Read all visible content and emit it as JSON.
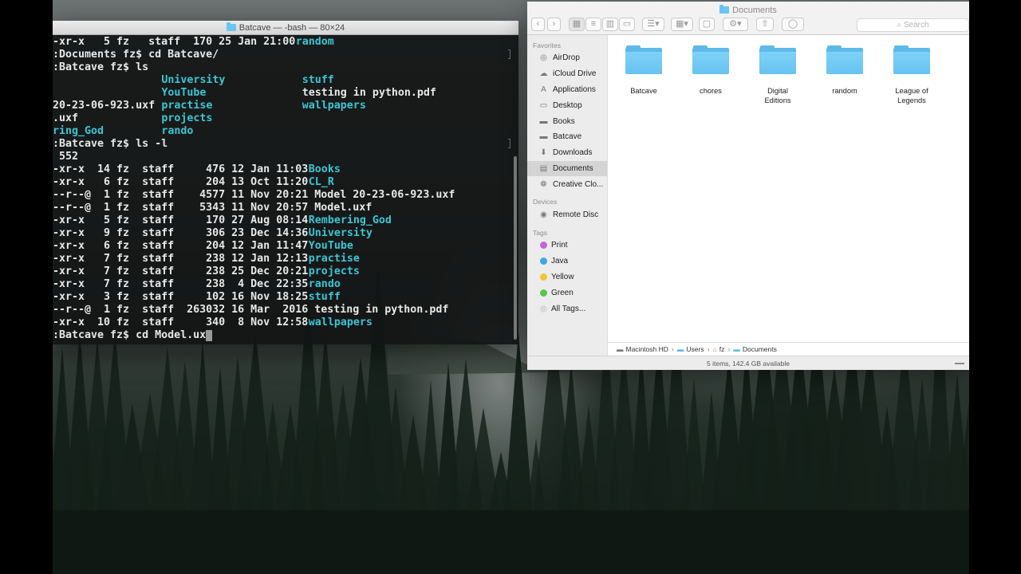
{
  "terminal": {
    "title": "Batcave — -bash — 80×24",
    "lines": [
      [
        {
          "t": "-xr-x   5 fz   staff  170 25 Jan 21:00 ",
          "c": "n",
          "col": 0
        },
        {
          "t": "random",
          "c": "d",
          "col": 38
        }
      ],
      [
        {
          "t": ":Documents fz$ cd Batcave/",
          "c": "n",
          "col": 0
        }
      ],
      [
        {
          "t": ":Batcave fz$ ls",
          "c": "n",
          "col": 0
        }
      ],
      [
        {
          "t": "University",
          "c": "d",
          "col": 17
        },
        {
          "t": "stuff",
          "c": "d",
          "col": 39
        }
      ],
      [
        {
          "t": "YouTube",
          "c": "d",
          "col": 17
        },
        {
          "t": "testing in python.pdf",
          "c": "n",
          "col": 39
        }
      ],
      [
        {
          "t": "20-23-06-923.uxf ",
          "c": "n",
          "col": 0
        },
        {
          "t": "practise",
          "c": "d",
          "col": 17
        },
        {
          "t": "wallpapers",
          "c": "d",
          "col": 39
        }
      ],
      [
        {
          "t": ".uxf",
          "c": "n",
          "col": 0
        },
        {
          "t": "projects",
          "c": "d",
          "col": 17
        }
      ],
      [
        {
          "t": "ring_God",
          "c": "d",
          "col": 0
        },
        {
          "t": "rando",
          "c": "d",
          "col": 17
        }
      ],
      [
        {
          "t": ":Batcave fz$ ls -l",
          "c": "n",
          "col": 0
        }
      ],
      [
        {
          "t": " 552",
          "c": "n",
          "col": 0
        }
      ],
      [
        {
          "t": "-xr-x  14 fz  staff     476 12 Jan 11:03 ",
          "c": "n",
          "col": 0
        },
        {
          "t": "Books",
          "c": "d",
          "col": 40
        }
      ],
      [
        {
          "t": "-xr-x   6 fz  staff     204 13 Oct 11:20 ",
          "c": "n",
          "col": 0
        },
        {
          "t": "CL_R",
          "c": "d",
          "col": 40
        }
      ],
      [
        {
          "t": "--r--@  1 fz  staff    4577 11 Nov 20:21 Model 20-23-06-923.uxf",
          "c": "n",
          "col": 0
        }
      ],
      [
        {
          "t": "--r--@  1 fz  staff    5343 11 Nov 20:57 Model.uxf",
          "c": "n",
          "col": 0
        }
      ],
      [
        {
          "t": "-xr-x   5 fz  staff     170 27 Aug 08:14 ",
          "c": "n",
          "col": 0
        },
        {
          "t": "Rembering_God",
          "c": "d",
          "col": 40
        }
      ],
      [
        {
          "t": "-xr-x   9 fz  staff     306 23 Dec 14:36 ",
          "c": "n",
          "col": 0
        },
        {
          "t": "University",
          "c": "d",
          "col": 40
        }
      ],
      [
        {
          "t": "-xr-x   6 fz  staff     204 12 Jan 11:47 ",
          "c": "n",
          "col": 0
        },
        {
          "t": "YouTube",
          "c": "d",
          "col": 40
        }
      ],
      [
        {
          "t": "-xr-x   7 fz  staff     238 12 Jan 12:13 ",
          "c": "n",
          "col": 0
        },
        {
          "t": "practise",
          "c": "d",
          "col": 40
        }
      ],
      [
        {
          "t": "-xr-x   7 fz  staff     238 25 Dec 20:21 ",
          "c": "n",
          "col": 0
        },
        {
          "t": "projects",
          "c": "d",
          "col": 40
        }
      ],
      [
        {
          "t": "-xr-x   7 fz  staff     238  4 Dec 22:35 ",
          "c": "n",
          "col": 0
        },
        {
          "t": "rando",
          "c": "d",
          "col": 40
        }
      ],
      [
        {
          "t": "-xr-x   3 fz  staff     102 16 Nov 18:25 ",
          "c": "n",
          "col": 0
        },
        {
          "t": "stuff",
          "c": "d",
          "col": 40
        }
      ],
      [
        {
          "t": "--r--@  1 fz  staff  263032 16 Mar  2016 testing in python.pdf",
          "c": "n",
          "col": 0
        }
      ],
      [
        {
          "t": "-xr-x  10 fz  staff     340  8 Nov 12:58 ",
          "c": "n",
          "col": 0
        },
        {
          "t": "wallpapers",
          "c": "d",
          "col": 40
        }
      ],
      [
        {
          "t": ":Batcave fz$ cd Model.ux",
          "c": "n",
          "col": 0
        }
      ]
    ],
    "colors": {
      "text": "#e8e8e8",
      "directory": "#3ec5d4",
      "background": "#141616"
    }
  },
  "finder": {
    "title": "Documents",
    "search_placeholder": "Search",
    "toolbar_icons": [
      "back-icon",
      "forward-icon",
      "icon-view-icon",
      "list-view-icon",
      "column-view-icon",
      "cover-flow-icon",
      "arrange-icon",
      "group-icon",
      "new-folder-icon",
      "action-gear-icon",
      "share-icon",
      "tag-icon"
    ],
    "sidebar": {
      "favorites_header": "Favorites",
      "favorites": [
        {
          "label": "AirDrop",
          "icon": "airdrop-icon",
          "glyph": "◎"
        },
        {
          "label": "iCloud Drive",
          "icon": "cloud-icon",
          "glyph": "☁"
        },
        {
          "label": "Applications",
          "icon": "applications-icon",
          "glyph": "A"
        },
        {
          "label": "Desktop",
          "icon": "desktop-icon",
          "glyph": "▭"
        },
        {
          "label": "Books",
          "icon": "folder-icon",
          "glyph": "▬"
        },
        {
          "label": "Batcave",
          "icon": "folder-icon",
          "glyph": "▬"
        },
        {
          "label": "Downloads",
          "icon": "downloads-icon",
          "glyph": "⬇"
        },
        {
          "label": "Documents",
          "icon": "documents-icon",
          "glyph": "▤"
        },
        {
          "label": "Creative Clo...",
          "icon": "creative-cloud-icon",
          "glyph": "❁"
        }
      ],
      "devices_header": "Devices",
      "devices": [
        {
          "label": "Remote Disc",
          "icon": "disc-icon",
          "glyph": "◉"
        }
      ],
      "tags_header": "Tags",
      "tags": [
        {
          "label": "Print",
          "color": "#c565d6"
        },
        {
          "label": "Java",
          "color": "#3fa6e6"
        },
        {
          "label": "Yellow",
          "color": "#f6c432"
        },
        {
          "label": "Green",
          "color": "#55c84a"
        },
        {
          "label": "All Tags...",
          "color": "#d9d9d9"
        }
      ]
    },
    "items": [
      "Batcave",
      "chores",
      "Digital Editions",
      "random",
      "League of Legends"
    ],
    "path": [
      "Macintosh HD",
      "Users",
      "fz",
      "Documents"
    ],
    "status": "5 items, 142.4 GB available",
    "colors": {
      "folder": "#67c3f1",
      "selected_row": "#d4d4d4"
    }
  }
}
